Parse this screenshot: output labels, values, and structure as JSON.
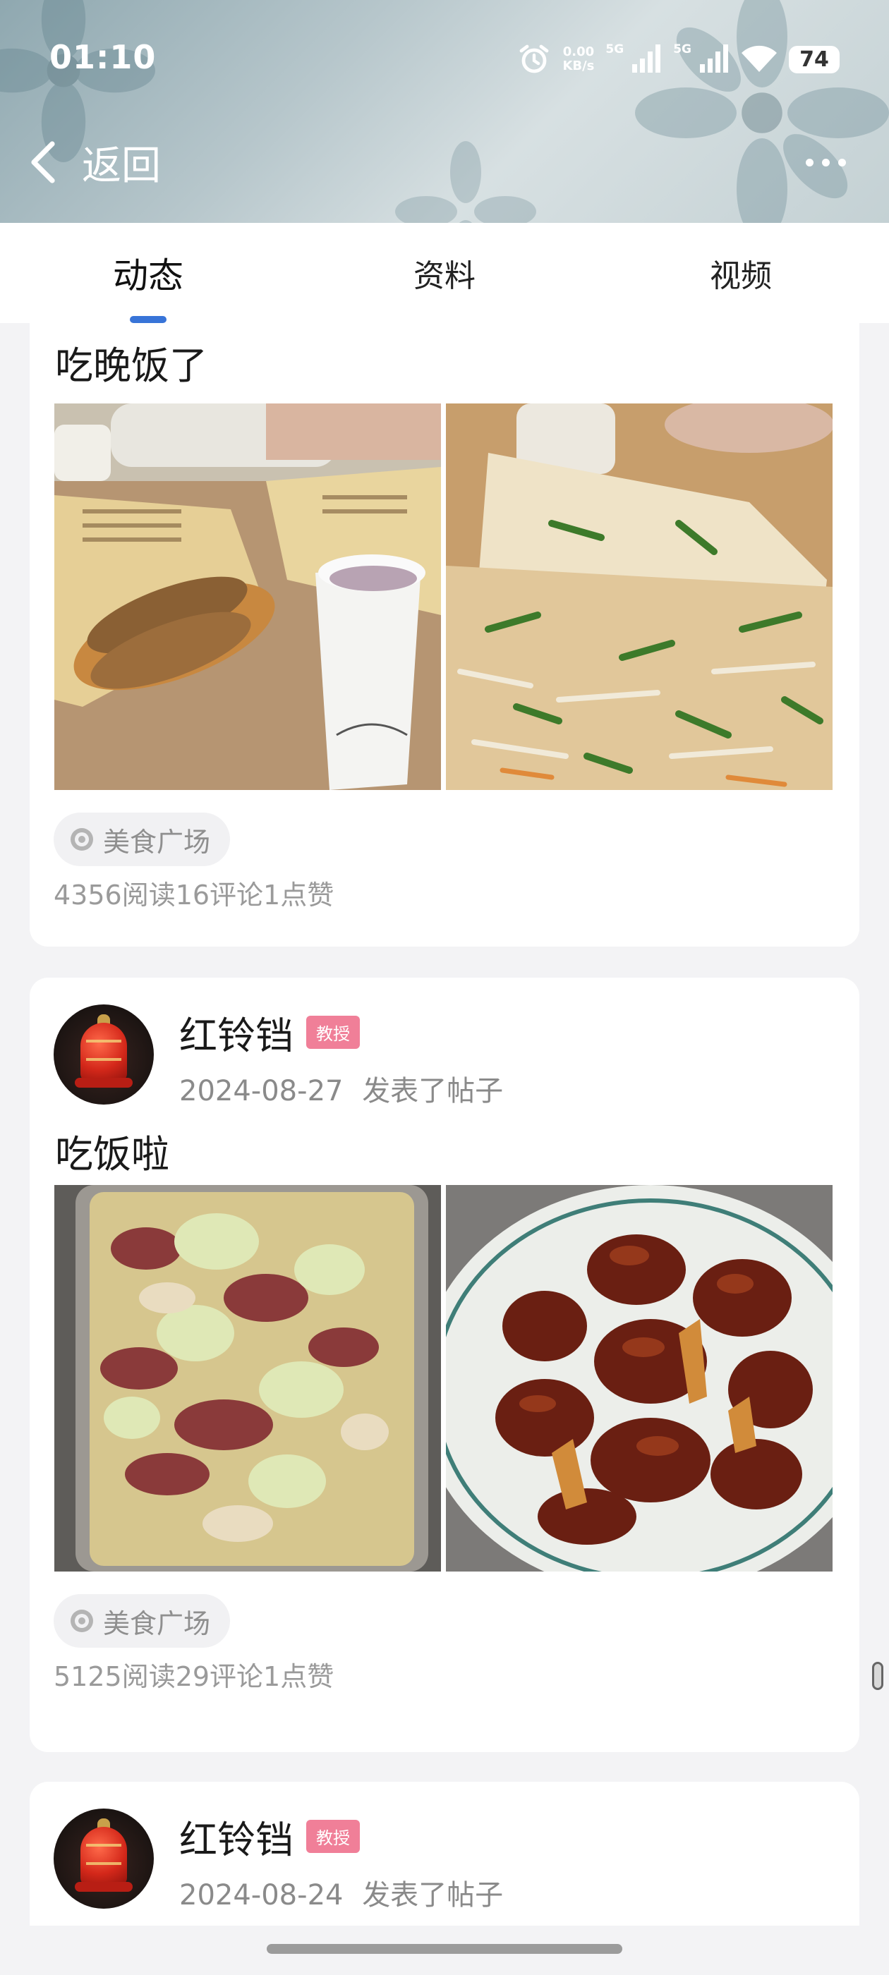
{
  "status_bar": {
    "time": "01:10",
    "net_speed_value": "0.00",
    "net_speed_unit": "KB/s",
    "signal1_label": "5G",
    "signal2_label": "5G",
    "battery": "74",
    "icons": [
      "alarm-icon",
      "signal-icon",
      "signal-icon",
      "wifi-icon",
      "battery-icon"
    ]
  },
  "nav": {
    "back_label": "返回",
    "icons": [
      "chevron-left-icon",
      "more-icon"
    ]
  },
  "tabs": [
    {
      "label": "动态",
      "active": true
    },
    {
      "label": "资料",
      "active": false
    },
    {
      "label": "视频",
      "active": false
    }
  ],
  "posts": [
    {
      "title": "吃晚饭了",
      "topic": "美食广场",
      "stats": "4356阅读16评论1点赞"
    },
    {
      "author": "红铃铛",
      "badge": "教授",
      "date": "2024-08-27",
      "action": "发表了帖子",
      "title": "吃饭啦",
      "topic": "美食广场",
      "stats": "5125阅读29评论1点赞"
    },
    {
      "author": "红铃铛",
      "badge": "教授",
      "date": "2024-08-24",
      "action": "发表了帖子"
    }
  ],
  "colors": {
    "accent": "#3874d8",
    "badge": "#f07f98",
    "muted_text": "#8a8a8a"
  }
}
